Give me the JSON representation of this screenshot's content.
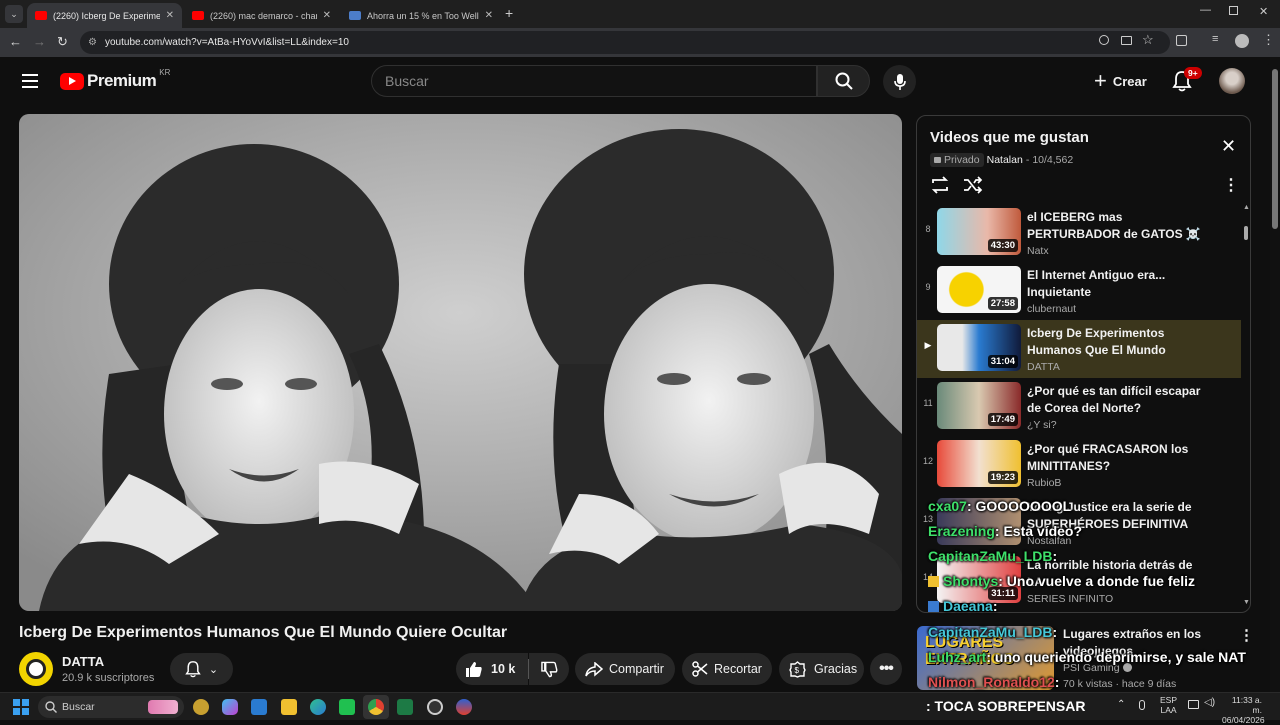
{
  "browser": {
    "tabs": [
      {
        "title": "(2260) Icberg De Experimentos",
        "active": true
      },
      {
        "title": "(2260) mac demarco - chamber",
        "active": false
      },
      {
        "title": "Ahorra un 15 % en Too Well H",
        "active": false
      }
    ],
    "url": "youtube.com/watch?v=AtBa-HYoVvI&list=LL&index=10"
  },
  "header": {
    "logo_text": "Premium",
    "region": "KR",
    "search_placeholder": "Buscar",
    "create_label": "Crear",
    "notif_count": "9+"
  },
  "video": {
    "title": "Icberg De Experimentos Humanos Que El Mundo Quiere Ocultar",
    "channel": "DATTA",
    "subscribers": "20.9 k suscriptores",
    "likes": "10 k",
    "share_label": "Compartir",
    "clip_label": "Recortar",
    "thanks_label": "Gracias"
  },
  "playlist": {
    "title": "Videos que me gustan",
    "privacy": "Privado",
    "owner": "Natalan",
    "position": "10/4,562",
    "items": [
      {
        "num": "8",
        "title": "el ICEBERG mas PERTURBADOR de GATOS ☠️",
        "channel": "Natx",
        "duration": "43:30"
      },
      {
        "num": "9",
        "title": "El Internet Antiguo era... Inquietante",
        "channel": "clubernaut",
        "duration": "27:58"
      },
      {
        "num": "▶",
        "title": "Icberg De Experimentos Humanos Que El Mundo Quier...",
        "channel": "DATTA",
        "duration": "31:04"
      },
      {
        "num": "11",
        "title": "¿Por qué es tan difícil escapar de Corea del Norte?",
        "channel": "¿Y si?",
        "duration": "17:49"
      },
      {
        "num": "12",
        "title": "¿Por qué FRACASARON los MINITITANES?",
        "channel": "RubioB",
        "duration": "19:23"
      },
      {
        "num": "13",
        "title": "Young Justice era la serie de SUPERHÉROES DEFINITIVA",
        "channel": "Nostalfan",
        "duration": ""
      },
      {
        "num": "14",
        "title": "La horrible historia detrás de LA",
        "channel": "SERIES INFINITO",
        "duration": "31:11"
      }
    ]
  },
  "rec": {
    "title": "Lugares extraños en los videojuegos",
    "thumb_text": "LUGARES EXTRAÑOS",
    "channel": "PSI Gaming",
    "meta": "70 k vistas · hace 9 días"
  },
  "chat": [
    {
      "user": "cxa07",
      "msg": ": GOOOOOOOL"
    },
    {
      "user": "Erazening",
      "msg": ": Esta vídeo?"
    },
    {
      "user": "CapitanZaMu_LDB",
      "msg": ":"
    },
    {
      "user": "Shontys",
      "msg": ": Uno vuelve a donde fue feliz"
    },
    {
      "user": "Daeana",
      "msg": ":"
    },
    {
      "user": "CapitanZaMu_LDB",
      "msg": ":"
    },
    {
      "user": "Luhz_art",
      "msg": ": uno queriendo deprimirse, y sale NAT"
    },
    {
      "user": "Nilmon_Ronaldo12",
      "msg": ":"
    }
  ],
  "overlay_text": ": TOCA SOBREPENSAR",
  "taskbar": {
    "search_label": "Buscar",
    "lang": "ESP",
    "lang2": "LAA",
    "time": "11:33 a. m.",
    "date": "06/04/2026"
  }
}
